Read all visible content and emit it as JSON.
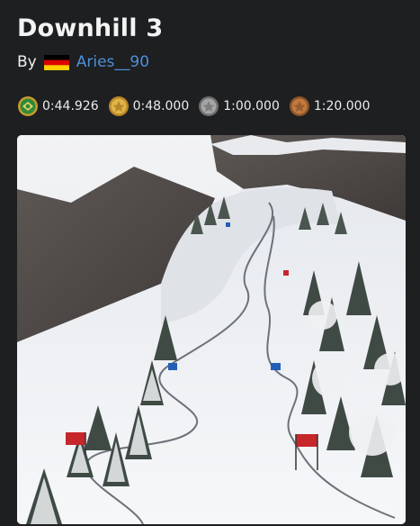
{
  "map": {
    "title": "Downhill 3",
    "by_label": "By",
    "author": "Aries__90",
    "author_flag": "germany-flag-icon",
    "thumbnail": "map-thumbnail"
  },
  "medals": [
    {
      "icon": "author-medal-icon",
      "time": "0:44.926",
      "color": "#2e8a3a"
    },
    {
      "icon": "gold-medal-icon",
      "time": "0:48.000",
      "color": "#d4a63b"
    },
    {
      "icon": "silver-medal-icon",
      "time": "1:00.000",
      "color": "#9a9a9a"
    },
    {
      "icon": "bronze-medal-icon",
      "time": "1:20.000",
      "color": "#b8753e"
    }
  ]
}
